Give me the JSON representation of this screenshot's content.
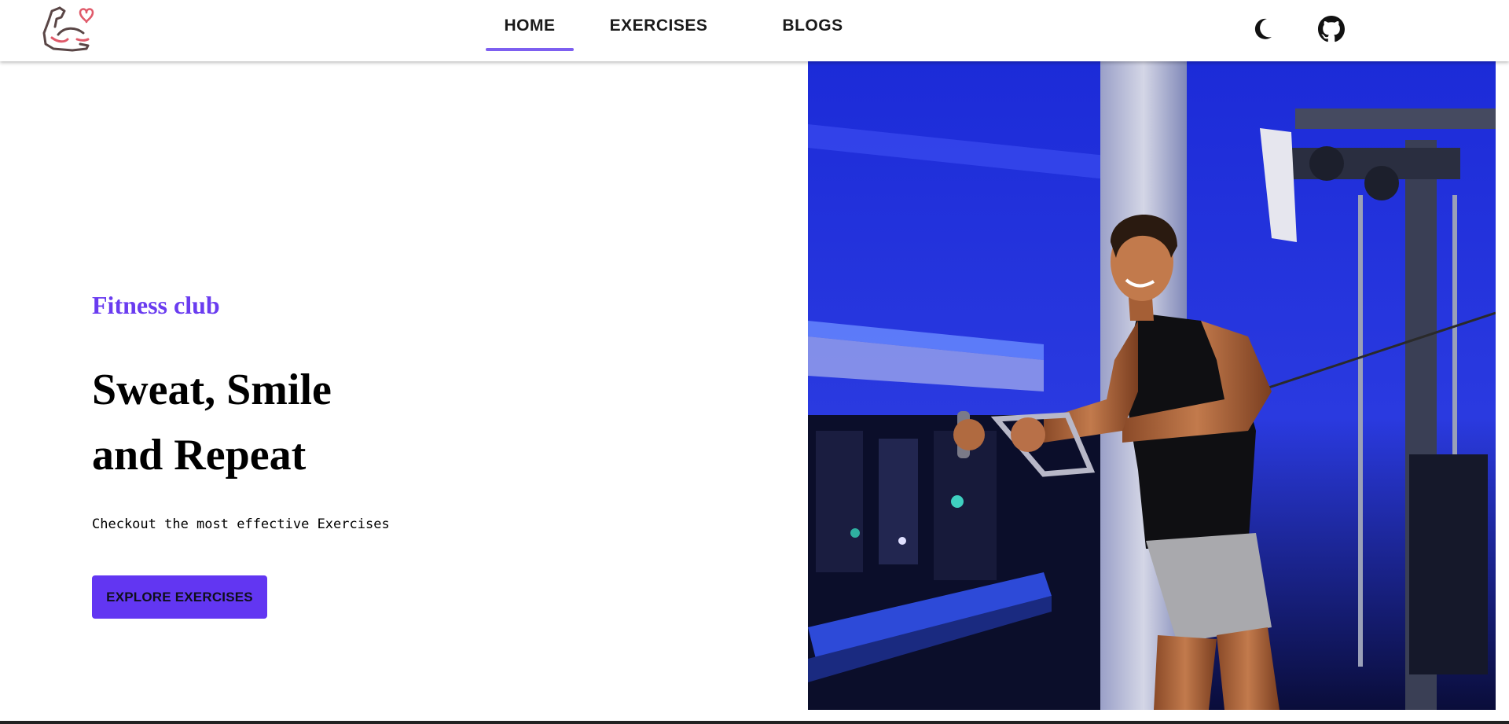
{
  "nav": {
    "logo_alt": "muscle-logo",
    "links": [
      {
        "label": "HOME",
        "active": true
      },
      {
        "label": "EXERCISES",
        "active": false
      },
      {
        "label": "BLOGS",
        "active": false
      }
    ],
    "theme_icon": "moon-icon",
    "github_icon": "github-icon"
  },
  "hero": {
    "subtitle": "Fitness club",
    "title_line1": "Sweat, Smile",
    "title_line2": "and Repeat",
    "text": "Checkout the most effective Exercises",
    "cta_label": "EXPLORE EXERCISES"
  },
  "colors": {
    "accent": "#6236f2",
    "subtitle": "#6a3cf0",
    "indicator": "#7d5ff0",
    "image_background": "#1f2fd6"
  }
}
